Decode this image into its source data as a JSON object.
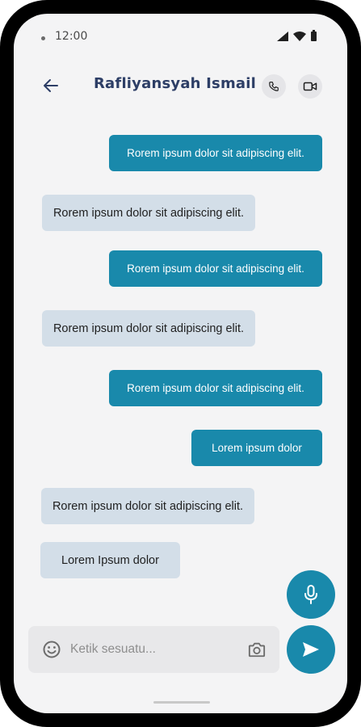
{
  "status_bar": {
    "time": "12:00"
  },
  "header": {
    "contact_name": "Rafliyansyah Ismail"
  },
  "messages": [
    {
      "direction": "sent",
      "text": "Rorem ipsum dolor sit  adipiscing elit."
    },
    {
      "direction": "received",
      "text": "Rorem ipsum dolor sit  adipiscing elit."
    },
    {
      "direction": "sent",
      "text": "Rorem ipsum dolor sit  adipiscing elit."
    },
    {
      "direction": "received",
      "text": "Rorem ipsum dolor sit  adipiscing elit."
    },
    {
      "direction": "sent",
      "text": "Rorem ipsum dolor sit  adipiscing elit."
    },
    {
      "direction": "sent",
      "text": "Lorem ipsum dolor"
    },
    {
      "direction": "received",
      "text": "Rorem ipsum dolor sit  adipiscing elit."
    },
    {
      "direction": "received",
      "text": "Lorem Ipsum dolor"
    }
  ],
  "composer": {
    "placeholder": "Ketik sesuatu...",
    "value": ""
  },
  "icons": {
    "back": "arrow-left-icon",
    "call": "phone-icon",
    "video": "video-camera-icon",
    "mic": "microphone-icon",
    "send": "send-icon",
    "emoji": "smiley-icon",
    "camera": "camera-icon"
  },
  "colors": {
    "accent": "#1989ab",
    "received_bubble": "#d3dee8",
    "title": "#2d3e66",
    "background": "#f4f4f5"
  }
}
